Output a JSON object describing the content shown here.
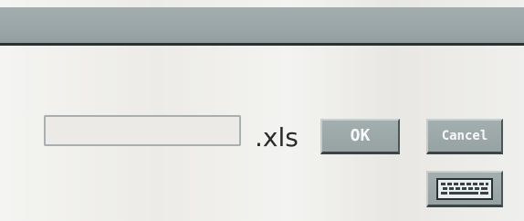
{
  "dialog": {
    "filename_value": "",
    "extension": ".xls",
    "ok_label": "OK",
    "cancel_label": "Cancel",
    "keyboard_icon": "keyboard-icon"
  },
  "colors": {
    "title_bar": "#9aa6a7",
    "button_face": "#9da8a8",
    "button_text": "#f8f8f8",
    "background": "#efefed"
  }
}
